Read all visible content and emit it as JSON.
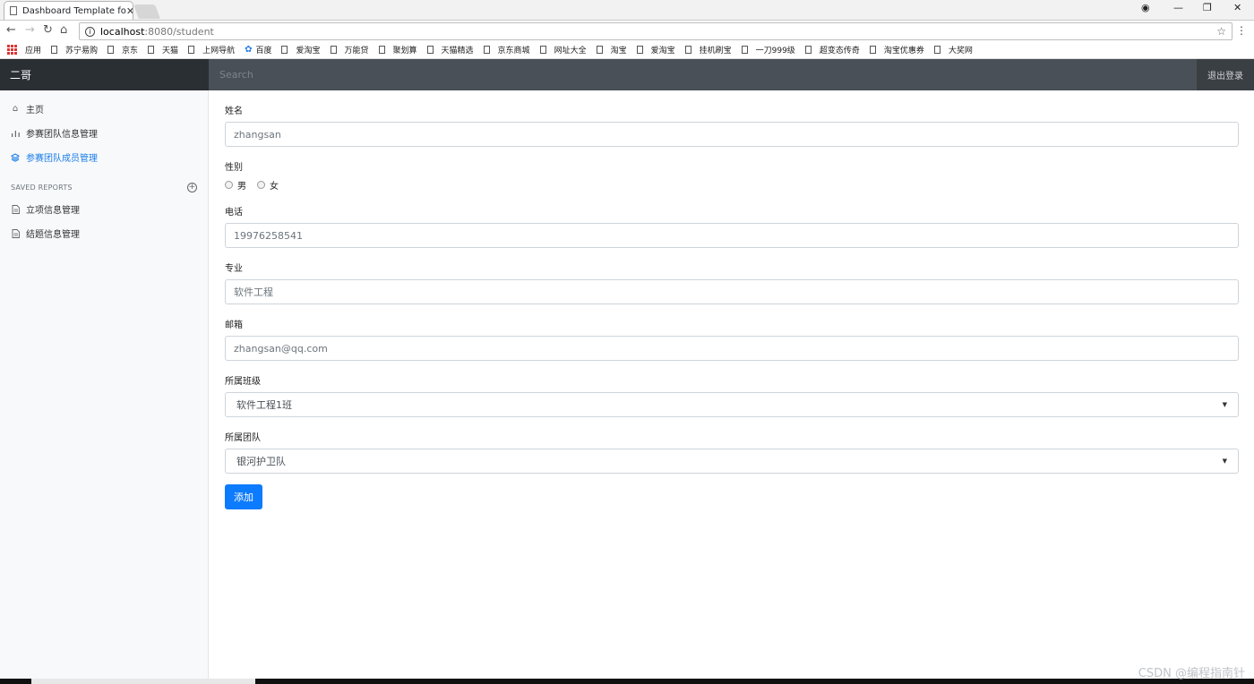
{
  "browser": {
    "tab_title": "Dashboard Template fo",
    "tab_close": "✕",
    "url_host": "localhost",
    "url_path": ":8080/student",
    "window_controls": {
      "account": "◉",
      "minimize": "—",
      "restore": "❐",
      "close": "✕"
    }
  },
  "bookmarks": [
    "应用",
    "苏宁易购",
    "京东",
    "天猫",
    "上网导航",
    "百度",
    "爱淘宝",
    "万能贷",
    "聚划算",
    "天猫精选",
    "京东商城",
    "网址大全",
    "淘宝",
    "爱淘宝",
    "挂机刷宝",
    "一刀999级",
    "超变态传奇",
    "淘宝优惠券",
    "大奖网"
  ],
  "header": {
    "brand": "二哥",
    "search_placeholder": "Search",
    "signout": "退出登录"
  },
  "sidebar": {
    "items": [
      {
        "label": "主页",
        "icon": "home-icon"
      },
      {
        "label": "参赛团队信息管理",
        "icon": "bar-chart-icon"
      },
      {
        "label": "参赛团队成员管理",
        "icon": "layers-icon",
        "active": true
      }
    ],
    "section_title": "SAVED REPORTS",
    "reports": [
      {
        "label": "立项信息管理",
        "icon": "file-text-icon"
      },
      {
        "label": "结题信息管理",
        "icon": "file-text-icon"
      }
    ]
  },
  "form": {
    "name": {
      "label": "姓名",
      "value": "zhangsan"
    },
    "gender": {
      "label": "性别",
      "options": [
        "男",
        "女"
      ]
    },
    "phone": {
      "label": "电话",
      "value": "19976258541"
    },
    "major": {
      "label": "专业",
      "value": "软件工程"
    },
    "email": {
      "label": "邮箱",
      "value": "zhangsan@qq.com"
    },
    "class": {
      "label": "所属班级",
      "selected": "软件工程1班"
    },
    "team": {
      "label": "所属团队",
      "selected": "银河护卫队"
    },
    "submit": "添加"
  },
  "watermark": "CSDN @编程指南针",
  "colors": {
    "accent": "#0d7bfd",
    "topbar": "#495057",
    "brand_bg": "#2a2f34",
    "sidebar_bg": "#f8f9fa"
  }
}
